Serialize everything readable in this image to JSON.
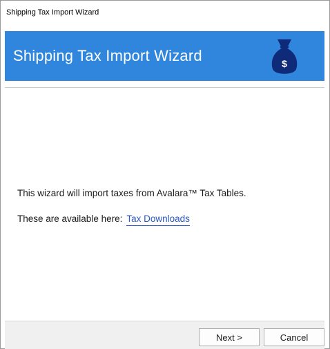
{
  "window": {
    "title": "Shipping Tax Import Wizard"
  },
  "banner": {
    "title": "Shipping Tax Import Wizard",
    "icon": "money-bag-icon",
    "icon_glyph": "$",
    "color": "#2f86dc",
    "icon_color": "#0f2a78"
  },
  "content": {
    "line1": "This wizard will import taxes from Avalara™ Tax Tables.",
    "line2_prefix": "These are available here:",
    "link_text": "Tax Downloads"
  },
  "buttons": {
    "next": "Next >",
    "cancel": "Cancel"
  }
}
